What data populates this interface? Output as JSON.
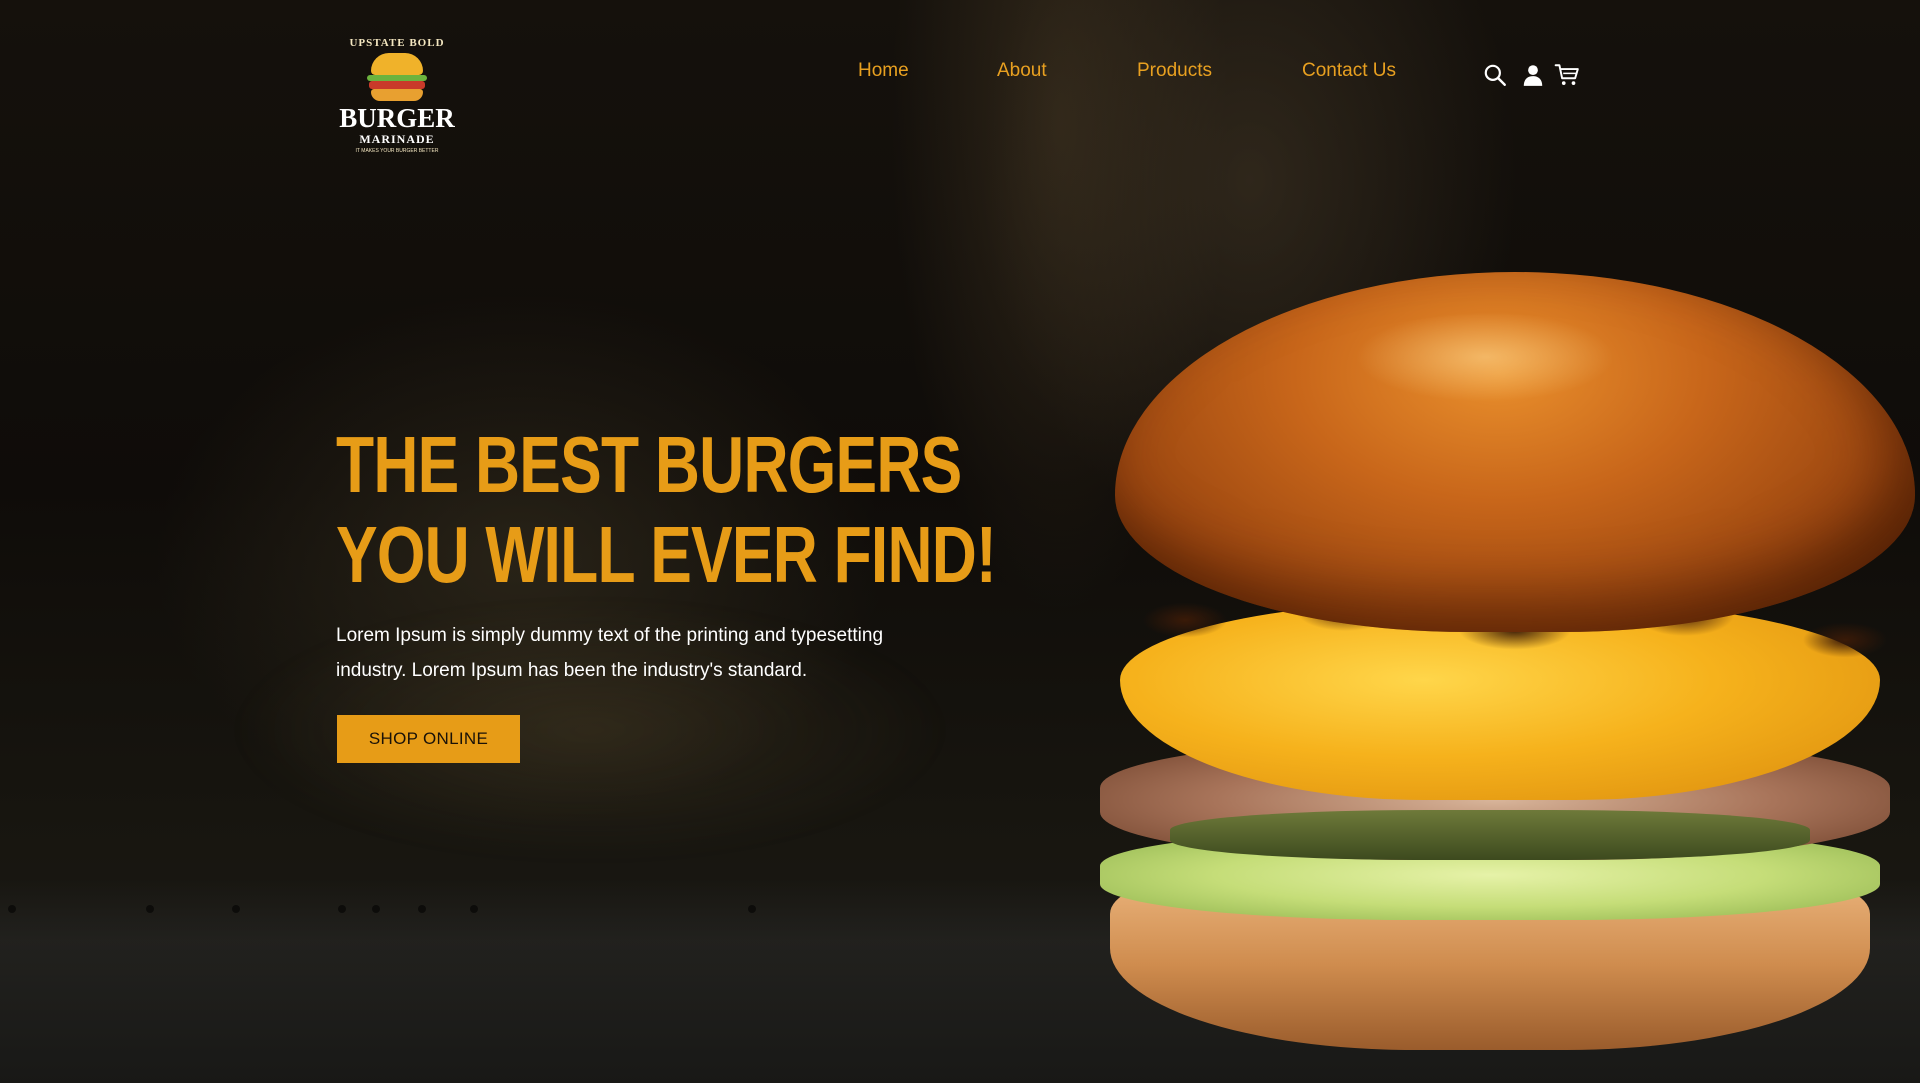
{
  "brand": {
    "logo_top_text": "UPSTATE BOLD",
    "logo_title": "BURGER",
    "logo_subtitle": "MARINADE",
    "logo_tagline": "IT MAKES YOUR BURGER BETTER"
  },
  "nav": {
    "items": [
      {
        "label": "Home"
      },
      {
        "label": "About"
      },
      {
        "label": "Products"
      },
      {
        "label": "Contact Us"
      }
    ],
    "color": "#e8a020"
  },
  "header_icons": [
    "search-icon",
    "user-icon",
    "cart-icon"
  ],
  "hero": {
    "headline_line1": "THE BEST BURGERS",
    "headline_line2": "YOU WILL EVER FIND!",
    "description_line1": "Lorem Ipsum is simply dummy text of the printing and typesetting",
    "description_line2": "industry. Lorem Ipsum has been the industry's standard.",
    "cta_label": "SHOP ONLINE",
    "accent_color": "#e79c17"
  }
}
